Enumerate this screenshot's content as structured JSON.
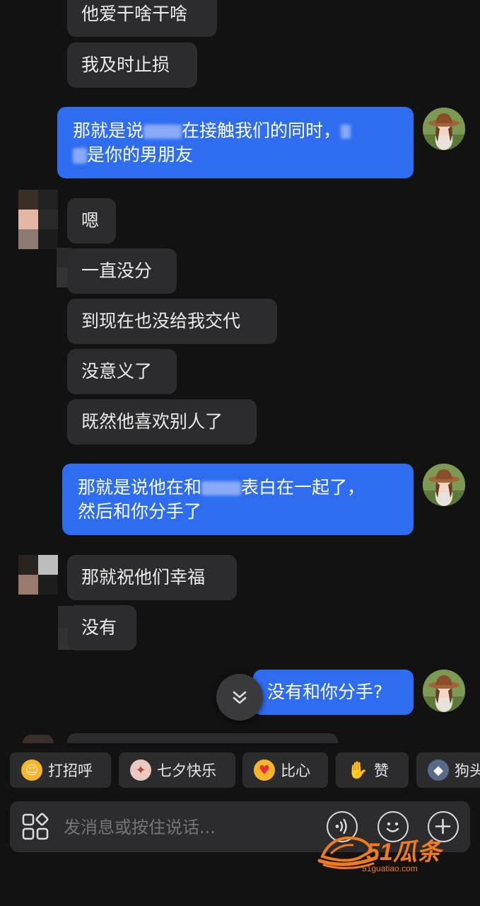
{
  "messages": {
    "top1": "他爱干啥干啥",
    "top2": "我及时止损",
    "out1_part1": "那就是说",
    "out1_part2": "在接触我们的同时，",
    "out1_part3": "是你的男朋友",
    "in1": "嗯",
    "in2": "一直没分",
    "in3": "到现在也没给我交代",
    "in4": "没意义了",
    "in5": "既然他喜欢别人了",
    "out2_part1": "那就是说他在和",
    "out2_part2": "表白在一起了，",
    "out2_part3": "然后和你分手了",
    "in6": "那就祝他们幸福",
    "in7": "没有",
    "out3": "没有和你分手?"
  },
  "quick_replies": [
    {
      "label": "打招呼",
      "icon": "smile-wave-icon"
    },
    {
      "label": "七夕快乐",
      "icon": "magpie-icon"
    },
    {
      "label": "比心",
      "icon": "heart-hands-icon"
    },
    {
      "label": "赞",
      "icon": "thumbs-up-icon"
    },
    {
      "label": "狗头",
      "icon": "dog-head-icon"
    }
  ],
  "input": {
    "placeholder": "发消息或按住说话..."
  },
  "watermark": {
    "brand": "51瓜条",
    "url": "51guatiao.com"
  },
  "colors": {
    "background": "#121212",
    "incoming_bubble": "#2c2c2e",
    "outgoing_bubble": "#2f6df0",
    "watermark": "#f07a1e"
  }
}
